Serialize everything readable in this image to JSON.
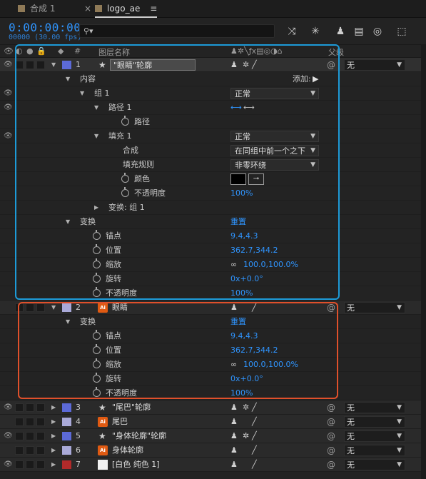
{
  "tabs": [
    {
      "label": "合成 1",
      "active": false
    },
    {
      "label": "logo_ae",
      "active": true
    }
  ],
  "toolbar": {
    "timecode": "0:00:00:00",
    "fps": "00000 (30.00 fps)",
    "search_placeholder": ""
  },
  "columns": {
    "num": "#",
    "name": "图层名称",
    "parent": "父级"
  },
  "rows": [
    {
      "type": "layer",
      "num": "1",
      "name": "\"眼睛\"轮廓",
      "label_color": "#5c6ad8",
      "kind": "shape",
      "parent": "无",
      "selected": true
    },
    {
      "type": "prop",
      "name": "内容",
      "extra": "添加:"
    },
    {
      "type": "prop",
      "name": "组 1",
      "dropdown": "正常"
    },
    {
      "type": "prop",
      "name": "路径 1"
    },
    {
      "type": "prop",
      "name": "路径"
    },
    {
      "type": "prop",
      "name": "填充 1",
      "dropdown": "正常"
    },
    {
      "type": "prop",
      "name": "合成",
      "dropdown": "在同组中前一个之下"
    },
    {
      "type": "prop",
      "name": "填充规则",
      "dropdown": "非零环绕"
    },
    {
      "type": "prop",
      "name": "颜色"
    },
    {
      "type": "prop",
      "name": "不透明度",
      "value": "100%"
    },
    {
      "type": "prop",
      "name": "变换: 组 1"
    },
    {
      "type": "prop",
      "name": "变换",
      "value": "重置"
    },
    {
      "type": "prop",
      "name": "锚点",
      "value": "9.4,4.3"
    },
    {
      "type": "prop",
      "name": "位置",
      "value": "362.7,344.2"
    },
    {
      "type": "prop",
      "name": "缩放",
      "value": "100.0,100.0%"
    },
    {
      "type": "prop",
      "name": "旋转",
      "value": "0x+0.0°"
    },
    {
      "type": "prop",
      "name": "不透明度",
      "value": "100%"
    },
    {
      "type": "layer",
      "num": "2",
      "name": "眼睛",
      "label_color": "#a9a9d8",
      "kind": "ai",
      "parent": "无"
    },
    {
      "type": "prop",
      "name": "变换",
      "value": "重置"
    },
    {
      "type": "prop",
      "name": "锚点",
      "value": "9.4,4.3"
    },
    {
      "type": "prop",
      "name": "位置",
      "value": "362.7,344.2"
    },
    {
      "type": "prop",
      "name": "缩放",
      "value": "100.0,100.0%"
    },
    {
      "type": "prop",
      "name": "旋转",
      "value": "0x+0.0°"
    },
    {
      "type": "prop",
      "name": "不透明度",
      "value": "100%"
    },
    {
      "type": "layer",
      "num": "3",
      "name": "\"尾巴\"轮廓",
      "label_color": "#5c6ad8",
      "kind": "shape",
      "parent": "无"
    },
    {
      "type": "layer",
      "num": "4",
      "name": "尾巴",
      "label_color": "#a9a9d8",
      "kind": "ai",
      "parent": "无"
    },
    {
      "type": "layer",
      "num": "5",
      "name": "\"身体轮廓\"轮廓",
      "label_color": "#5c6ad8",
      "kind": "shape",
      "parent": "无"
    },
    {
      "type": "layer",
      "num": "6",
      "name": "身体轮廓",
      "label_color": "#a9a9d8",
      "kind": "ai",
      "parent": "无"
    },
    {
      "type": "layer",
      "num": "7",
      "name": "[白色 纯色 1]",
      "label_color": "#b22a2a",
      "kind": "solid",
      "parent": "无"
    }
  ],
  "ai_badge": "Ai"
}
